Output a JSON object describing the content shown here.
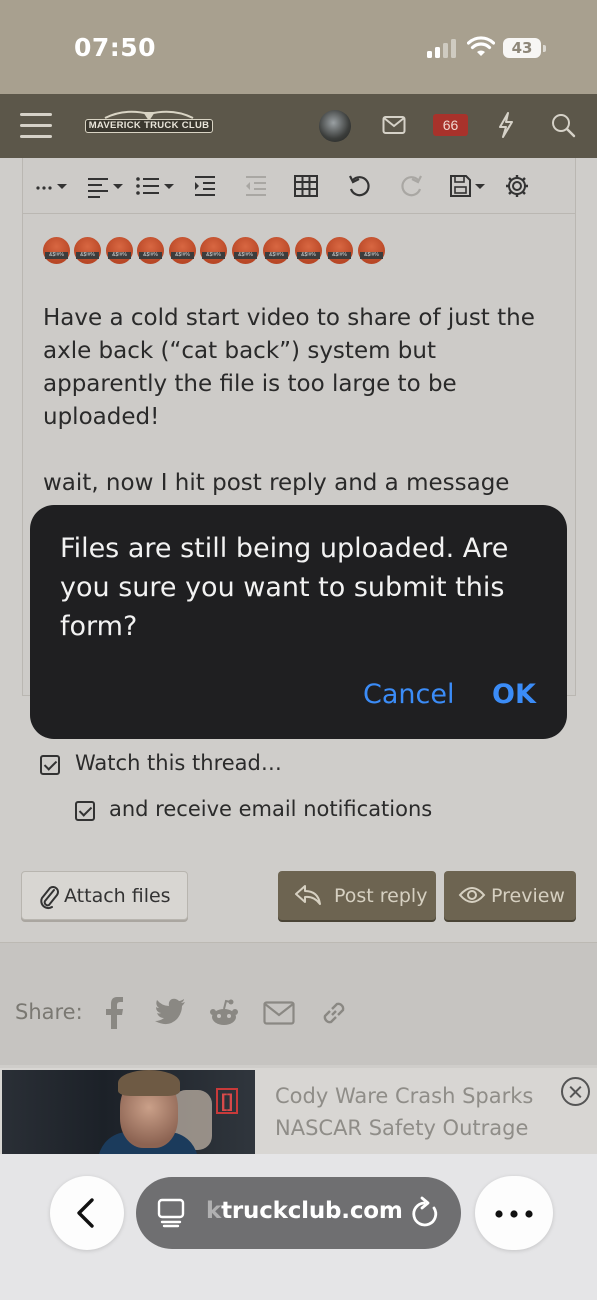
{
  "status_bar": {
    "time": "07:50",
    "battery": "43",
    "icons": [
      "cellular-signal-icon",
      "wifi-icon",
      "battery-icon"
    ]
  },
  "header": {
    "logo_text": "MAVERICK TRUCK CLUB",
    "alerts_count": "66",
    "icons": [
      "menu-icon",
      "avatar",
      "inbox-icon",
      "bolt-icon",
      "search-icon"
    ]
  },
  "editor": {
    "toolbar_icons": [
      "more-options-icon",
      "align-icon",
      "list-icon",
      "indent-icon",
      "outdent-icon",
      "table-icon",
      "undo-icon",
      "redo-icon",
      "save-draft-icon",
      "settings-icon"
    ],
    "emoji_label": "&$!#%",
    "emoji_count": 11,
    "paragraphs": [
      "Have a cold start video to share of just the axle back (“cat back”) system but apparently the file is too large to be uploaded!",
      "wait, now I hit post reply and a message"
    ]
  },
  "options": {
    "watch_thread": "Watch this thread…",
    "email_notifications": "and receive email notifications"
  },
  "buttons": {
    "attach": "Attach files",
    "post_reply": "Post reply",
    "preview": "Preview"
  },
  "share": {
    "label": "Share:",
    "icons": [
      "facebook-icon",
      "twitter-icon",
      "reddit-icon",
      "email-icon",
      "link-icon"
    ]
  },
  "ad": {
    "headline": "Cody Ware Crash Sparks NASCAR Safety Outrage",
    "badge_glyph": "[]"
  },
  "browser": {
    "url_faded": "k",
    "url": "truckclub.com",
    "icons": [
      "back-icon",
      "tabs-icon",
      "reload-icon",
      "more-icon"
    ]
  },
  "dialog": {
    "message": "Files are still being uploaded. Are you sure you want to submit this form?",
    "cancel": "Cancel",
    "ok": "OK"
  },
  "colors": {
    "accent_blue": "#3b8cf7",
    "header_brown": "#5c574a",
    "button_brown": "#6d6451",
    "badge_red": "#a8322b"
  }
}
